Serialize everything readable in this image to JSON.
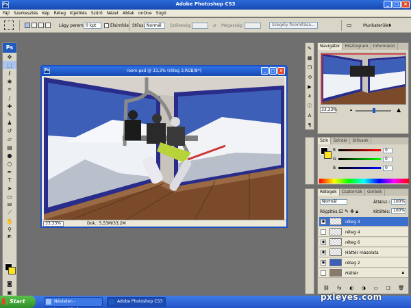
{
  "app": {
    "title": "Adobe Photoshop CS3",
    "logo": "Ps"
  },
  "menu": [
    "Fájl",
    "Szerkesztés",
    "Kép",
    "Réteg",
    "Kijelölés",
    "Szűrő",
    "Nézet",
    "Ablak",
    "onOne",
    "Súgó"
  ],
  "options_bar": {
    "feather_label": "Lágy perem:",
    "feather_value": "0 kpt",
    "antialias_label": "Élsimítás",
    "style_label": "Stílus:",
    "style_value": "Normál",
    "width_label": "Szélesség:",
    "height_label": "Magasság:",
    "refine_edge": "Szegély finomítása...",
    "workspace": "Munkaterület"
  },
  "document": {
    "title": "room.psd @ 33,3% (réteg 3,RGB/8*)",
    "zoom": "33,33%",
    "doc_info": "Dok.: 5,53M/33,2M"
  },
  "navigator": {
    "tabs": [
      "Navigátor",
      "Hisztogram",
      "Információ"
    ],
    "zoom": "33,33%"
  },
  "color_panel": {
    "tabs": [
      "Szín",
      "Színtár",
      "Stílusok"
    ],
    "channels": [
      {
        "label": "R",
        "value": "0",
        "color": "#d33"
      },
      {
        "label": "G",
        "value": "0",
        "color": "#3a3"
      },
      {
        "label": "B",
        "value": "0",
        "color": "#33d"
      }
    ],
    "foreground": "#000000",
    "background": "#ffe51a"
  },
  "layers_panel": {
    "tabs": [
      "Rétegek",
      "Csatornák",
      "Görbék"
    ],
    "blend_mode": "Normál",
    "opacity_label": "Átlátsz.:",
    "opacity": "100%",
    "lock_label": "Rögzítés:",
    "fill_label": "Kitöltés:",
    "fill": "100%",
    "layers": [
      {
        "name": "réteg 3",
        "visible": true,
        "selected": true
      },
      {
        "name": "réteg 4",
        "visible": false,
        "selected": false
      },
      {
        "name": "réteg 6",
        "visible": true,
        "selected": false
      },
      {
        "name": "Háttér másolata",
        "visible": true,
        "selected": false
      },
      {
        "name": "réteg 2",
        "visible": true,
        "selected": false
      },
      {
        "name": "Háttér",
        "visible": false,
        "selected": false
      }
    ]
  },
  "taskbar": {
    "start": "Start",
    "tasks": [
      {
        "label": "Névtelen - Jegyzettömb",
        "active": false
      },
      {
        "label": "Adobe Photoshop CS3",
        "active": true
      }
    ]
  },
  "watermark": "pxleyes.com"
}
